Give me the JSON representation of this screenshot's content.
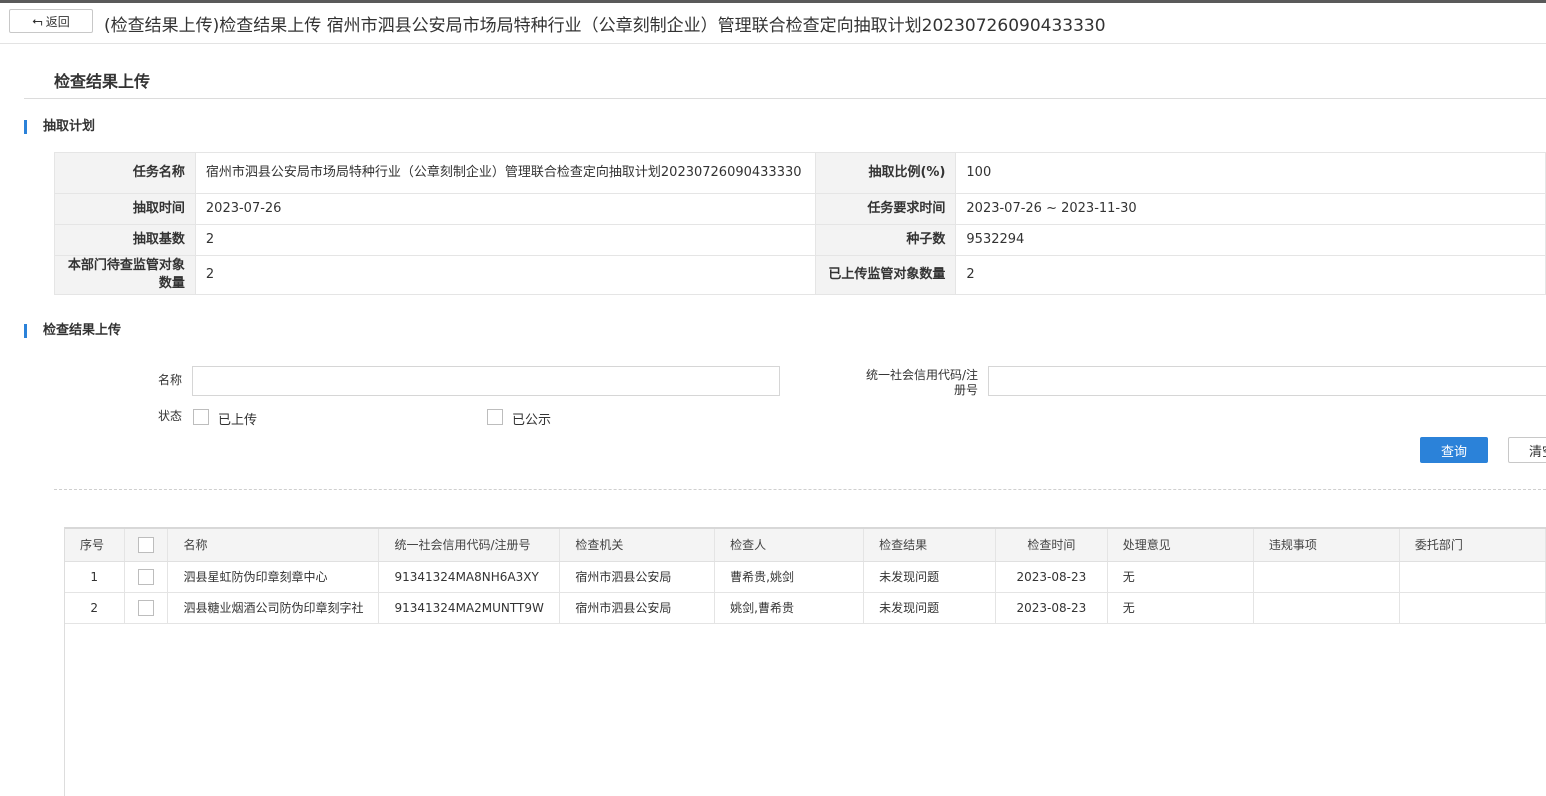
{
  "header": {
    "back_label": "返回",
    "title": "(检查结果上传)检查结果上传 宿州市泗县公安局市场局特种行业（公章刻制企业）管理联合检查定向抽取计划20230726090433330"
  },
  "page_title": "检查结果上传",
  "plan_section": {
    "title": "抽取计划",
    "rows": [
      {
        "label1": "任务名称",
        "value1": "宿州市泗县公安局市场局特种行业（公章刻制企业）管理联合检查定向抽取计划20230726090433330",
        "label2": "抽取比例(%)",
        "value2": "100"
      },
      {
        "label1": "抽取时间",
        "value1": "2023-07-26",
        "label2": "任务要求时间",
        "value2": "2023-07-26 ~ 2023-11-30"
      },
      {
        "label1": "抽取基数",
        "value1": "2",
        "label2": "种子数",
        "value2": "9532294"
      },
      {
        "label1": "本部门待查监管对象数量",
        "value1": "2",
        "label2": "已上传监管对象数量",
        "value2": "2"
      }
    ]
  },
  "upload_section": {
    "title": "检查结果上传",
    "name_label": "名称",
    "name_value": "",
    "code_label": "统一社会信用代码/注册号",
    "code_value": "",
    "status_label": "状态",
    "status_options": [
      "已上传",
      "已公示"
    ],
    "query_button": "查询",
    "clear_button": "清空"
  },
  "table": {
    "headers": [
      "序号",
      "",
      "名称",
      "统一社会信用代码/注册号",
      "检查机关",
      "检查人",
      "检查结果",
      "检查时间",
      "处理意见",
      "违规事项",
      "委托部门"
    ],
    "rows": [
      [
        "1",
        "",
        "泗县星虹防伪印章刻章中心",
        "91341324MA8NH6A3XY",
        "宿州市泗县公安局",
        "曹希贵,姚剑",
        "未发现问题",
        "2023-08-23",
        "无",
        "",
        ""
      ],
      [
        "2",
        "",
        "泗县糖业烟酒公司防伪印章刻字社",
        "91341324MA2MUNTT9W",
        "宿州市泗县公安局",
        "姚剑,曹希贵",
        "未发现问题",
        "2023-08-23",
        "无",
        "",
        ""
      ]
    ]
  },
  "icons": {
    "back": "back-arrow-icon"
  }
}
